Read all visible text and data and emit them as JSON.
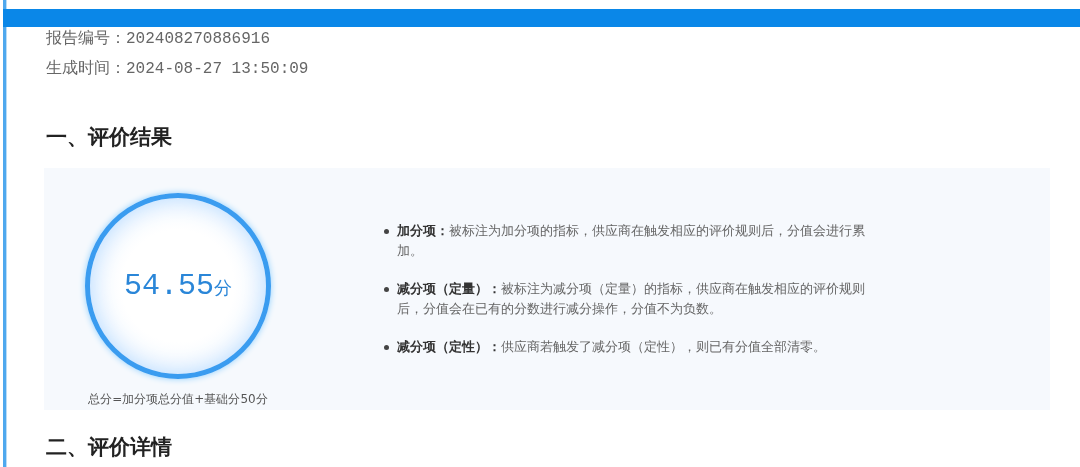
{
  "report_meta": [
    {
      "label": "报告编号：",
      "value": "202408270886916"
    },
    {
      "label": "生成时间：",
      "value": "2024-08-27 13:50:09"
    }
  ],
  "section_1": {
    "title": "一、评价结果",
    "score": {
      "value": "54.55",
      "unit": "分",
      "caption": "总分=加分项总分值+基础分50分"
    },
    "rules": [
      "**加分项：**被标注为加分项的指标，供应商在触发相应的评价规则后，分值会进行累加。",
      "**减分项（定量）：**被标注为减分项（定量）的指标，供应商在触发相应的评价规则后，分值会在已有的分数进行减分操作，分值不为负数。",
      "**减分项（定性）：**供应商若触发了减分项（定性），则已有分值全部清零。"
    ]
  },
  "section_2": {
    "title": "二、评价详情"
  }
}
